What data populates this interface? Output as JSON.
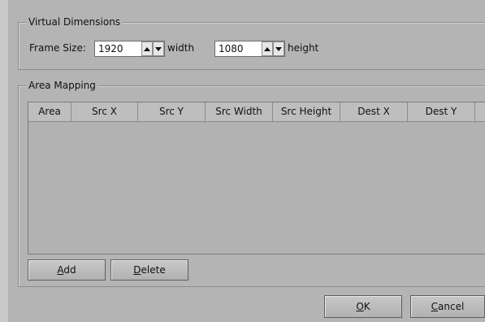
{
  "virtual_dimensions": {
    "title": "Virtual Dimensions",
    "frame_size_label": "Frame Size:",
    "width": {
      "value": "1920",
      "label": "width"
    },
    "height": {
      "value": "1080",
      "label": "height"
    }
  },
  "area_mapping": {
    "title": "Area Mapping",
    "columns": [
      "Area",
      "Src X",
      "Src Y",
      "Src Width",
      "Src Height",
      "Dest X",
      "Dest Y"
    ],
    "rows": []
  },
  "buttons": {
    "add": {
      "mnemonic": "A",
      "rest": "dd"
    },
    "delete": {
      "mnemonic": "D",
      "rest": "elete"
    },
    "ok": {
      "mnemonic": "O",
      "rest": "K"
    },
    "cancel": {
      "mnemonic": "C",
      "rest": "ancel"
    }
  }
}
